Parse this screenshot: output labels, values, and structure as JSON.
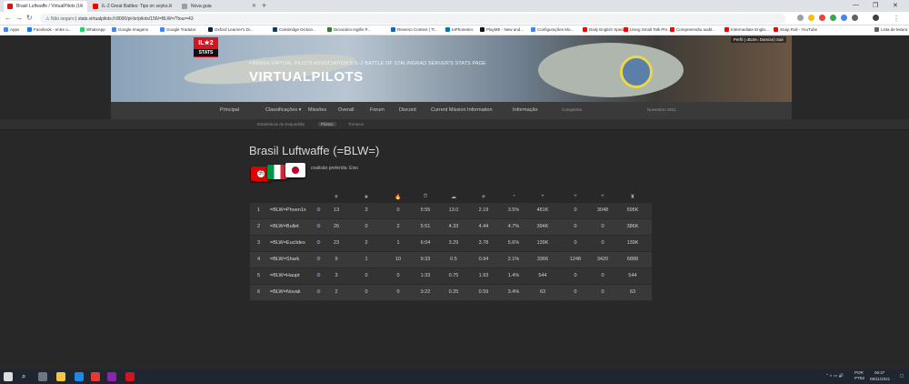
{
  "browser": {
    "tabs": [
      {
        "title": "Brasil Luftwaffe / VirtualPilots (I...",
        "active": true,
        "color": "#d4141e"
      },
      {
        "title": "IL-2 Great Battles: Tips on seyko...",
        "active": false,
        "color": "#ff0000"
      },
      {
        "title": "Nova guia",
        "active": false,
        "color": "#9aa0a6"
      }
    ],
    "url_prefix": "Não seguro",
    "url": "stats.virtualpilots.fi:8000/pt-br/pilots/156/=BLW=/?tour=43",
    "bookmarks": [
      {
        "label": "Apps",
        "color": "#4285f4"
      },
      {
        "label": "Facebook - entre o...",
        "color": "#1877f2"
      },
      {
        "label": "WhatsApp",
        "color": "#25d366"
      },
      {
        "label": "Google Imagens",
        "color": "#4285f4"
      },
      {
        "label": "Google Tradutor",
        "color": "#4285f4"
      },
      {
        "label": "Oxford Learner's Di...",
        "color": "#002147"
      },
      {
        "label": "Cambridge Diction...",
        "color": "#0d3b66"
      },
      {
        "label": "Dicionário Inglês P...",
        "color": "#2e7d32"
      },
      {
        "label": "Reverso Context | Tr...",
        "color": "#1565c0"
      },
      {
        "label": "toPhonetics",
        "color": "#0277bd"
      },
      {
        "label": "PlayME - New and...",
        "color": "#111111"
      },
      {
        "label": "Configurações Mo...",
        "color": "#4285f4"
      },
      {
        "label": "Daily English Speaki...",
        "color": "#ff0000"
      },
      {
        "label": "Using Small Talk Phr...",
        "color": "#ff0000"
      },
      {
        "label": "Compreensão audit...",
        "color": "#ff0000"
      },
      {
        "label": "Intermediate Englis...",
        "color": "#ff0000"
      },
      {
        "label": "Snap Roll - YouTube",
        "color": "#ff0000"
      },
      {
        "label": "Lista de leitura",
        "color": "#5f6368"
      }
    ]
  },
  "site": {
    "logo_top": "IL★2",
    "logo_bottom": "STATS",
    "subtitle": "FINNISH VIRTUAL PILOTS ASSOCIATION'S IL-2 BATTLE OF STALINGRAD SERVER'S STATS PAGE",
    "title": "VIRTUALPILOTS",
    "profile": "Perfil (=BLW= Damian)  Sair",
    "nav": [
      "Principal",
      "Classificações ▾",
      "Missões",
      "Overall",
      "Forum",
      "Discord",
      "Current Mission Information",
      "Informação",
      "Campanha",
      "Novembro 2021"
    ],
    "subnav": [
      "Estatísticas do Esquadrão",
      "Pilotos",
      "Torneios"
    ],
    "subnav_active": 1
  },
  "squad": {
    "name": "Brasil Luftwaffe (=BLW=)",
    "coalition": "coalisão preferida: Eixo"
  },
  "table": {
    "header_icons": [
      "✈",
      "★",
      "🔥",
      "⏱",
      "☁",
      "✈",
      "◔",
      "+",
      "+",
      "+",
      "♜"
    ],
    "rows": [
      {
        "rank": "1",
        "pilot": "=BLW=Phoen1x",
        "values": [
          "13",
          "3",
          "0",
          "5:55",
          "13.0",
          "2.19",
          "3.5%",
          "481K",
          "0",
          "3048",
          "595K"
        ]
      },
      {
        "rank": "2",
        "pilot": "=BLW=Bullet",
        "values": [
          "26",
          "0",
          "2",
          "5:51",
          "4.33",
          "4.44",
          "4.7%",
          "394K",
          "0",
          "0",
          "386K"
        ]
      },
      {
        "rank": "3",
        "pilot": "=BLW=Euclides",
        "values": [
          "23",
          "2",
          "1",
          "6:04",
          "3.29",
          "3.78",
          "5.6%",
          "139K",
          "0",
          "0",
          "139K"
        ]
      },
      {
        "rank": "4",
        "pilot": "=BLW=Shark",
        "values": [
          "9",
          "1",
          "10",
          "9:33",
          "0.5",
          "0.94",
          "2.1%",
          "3366",
          "1248",
          "3420",
          "6888"
        ]
      },
      {
        "rank": "5",
        "pilot": "=BLW=Haupt",
        "values": [
          "3",
          "0",
          "0",
          "1:33",
          "0.75",
          "1.93",
          "1.4%",
          "544",
          "0",
          "0",
          "544"
        ]
      },
      {
        "rank": "6",
        "pilot": "=BLW=Novak",
        "values": [
          "2",
          "0",
          "0",
          "3:22",
          "0.25",
          "0.59",
          "3.4%",
          "63",
          "0",
          "0",
          "63"
        ]
      }
    ]
  },
  "taskbar": {
    "lang": "POR\nPTB2",
    "time": "06:37",
    "date": "09/11/2021"
  }
}
